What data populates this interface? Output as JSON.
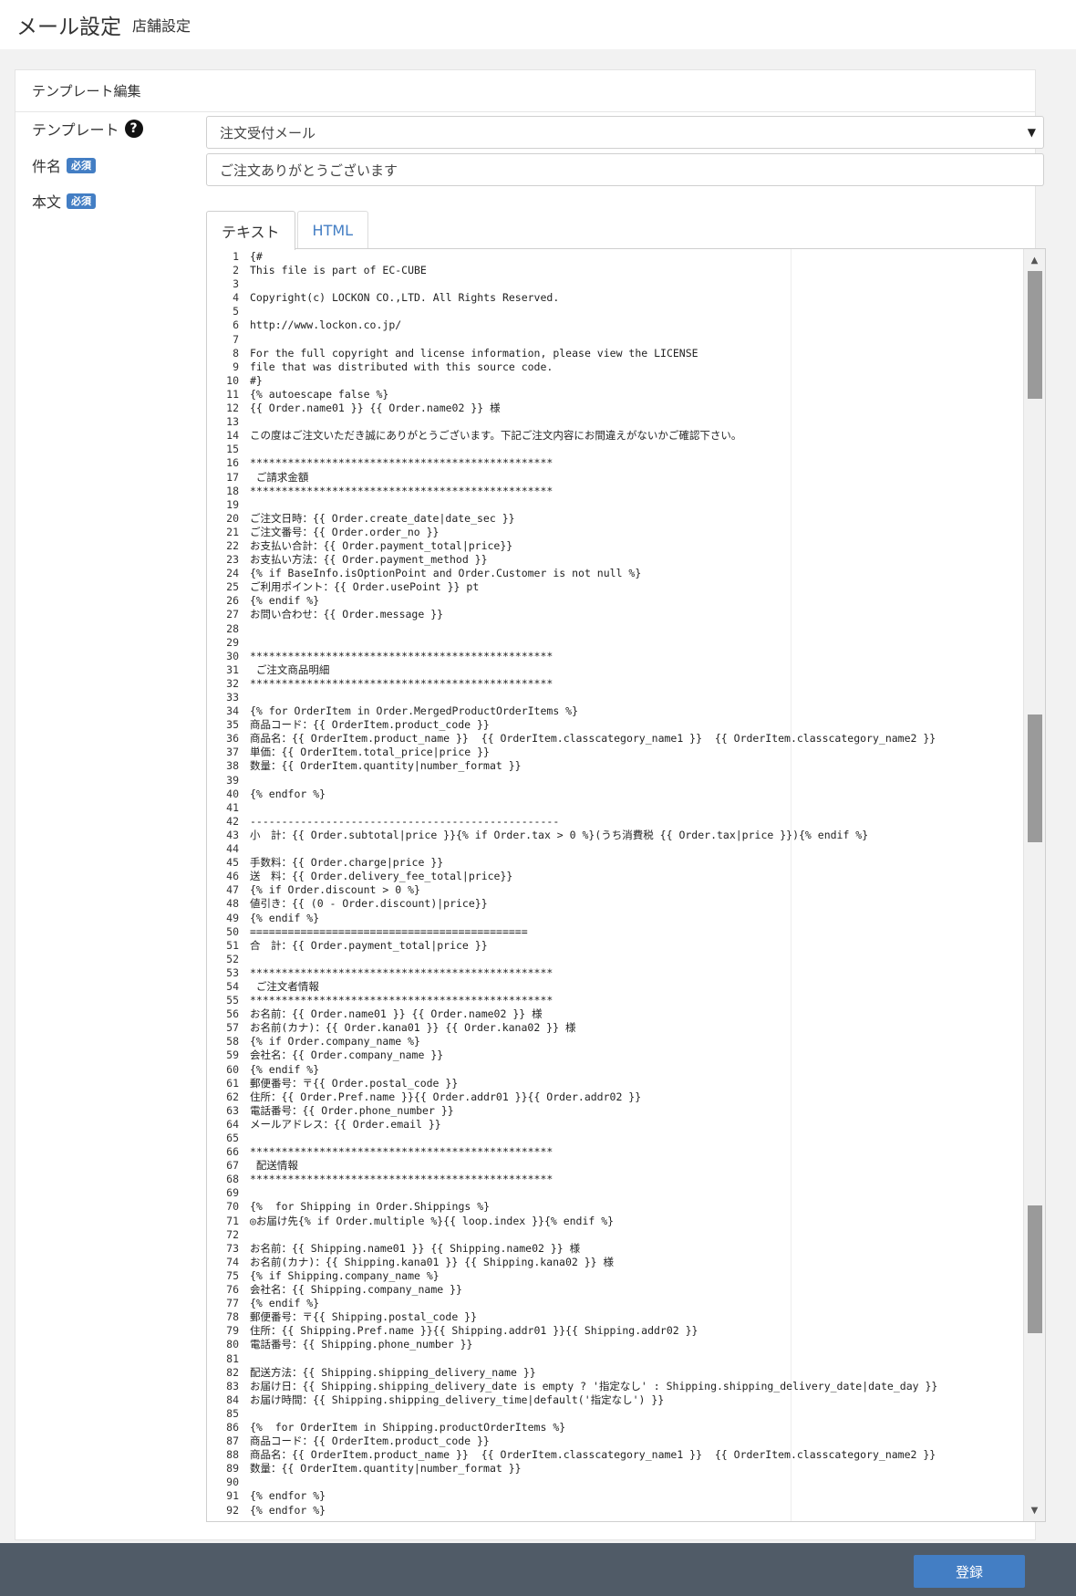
{
  "header": {
    "title": "メール設定",
    "subtitle": "店舗設定"
  },
  "card": {
    "title": "テンプレート編集"
  },
  "form": {
    "template_label": "テンプレート",
    "template_value": "注文受付メール",
    "subject_label": "件名",
    "required_badge": "必須",
    "subject_value": "ご注文ありがとうございます",
    "body_label": "本文"
  },
  "tabs": [
    {
      "label": "テキスト",
      "active": true
    },
    {
      "label": "HTML",
      "active": false
    }
  ],
  "editor": {
    "lines": [
      {
        "n": "1",
        "text": "{#"
      },
      {
        "n": "2",
        "text": "This file is part of EC-CUBE"
      },
      {
        "n": "3",
        "text": ""
      },
      {
        "n": "4",
        "text": "Copyright(c) LOCKON CO.,LTD. All Rights Reserved."
      },
      {
        "n": "5",
        "text": ""
      },
      {
        "n": "6",
        "text": "http://www.lockon.co.jp/"
      },
      {
        "n": "7",
        "text": ""
      },
      {
        "n": "8",
        "text": "For the full copyright and license information, please view the LICENSE"
      },
      {
        "n": "9",
        "text": "file that was distributed with this source code."
      },
      {
        "n": "10",
        "text": "#}"
      },
      {
        "n": "11",
        "text": "{% autoescape false %}"
      },
      {
        "n": "12",
        "text": "{{ Order.name01 }} {{ Order.name02 }} 様"
      },
      {
        "n": "13",
        "text": ""
      },
      {
        "n": "14",
        "text": "この度はご注文いただき誠にありがとうございます。下記ご注文内容にお間違えがないかご確認下さい。"
      },
      {
        "n": "15",
        "text": ""
      },
      {
        "n": "16",
        "text": "************************************************"
      },
      {
        "n": "17",
        "text": " ご請求金額"
      },
      {
        "n": "18",
        "text": "************************************************"
      },
      {
        "n": "19",
        "text": ""
      },
      {
        "n": "20",
        "text": "ご注文日時：{{ Order.create_date|date_sec }}"
      },
      {
        "n": "21",
        "text": "ご注文番号：{{ Order.order_no }}"
      },
      {
        "n": "22",
        "text": "お支払い合計：{{ Order.payment_total|price}}"
      },
      {
        "n": "23",
        "text": "お支払い方法：{{ Order.payment_method }}"
      },
      {
        "n": "24",
        "text": "{% if BaseInfo.isOptionPoint and Order.Customer is not null %}"
      },
      {
        "n": "25",
        "text": "ご利用ポイント：{{ Order.usePoint }} pt"
      },
      {
        "n": "26",
        "text": "{% endif %}"
      },
      {
        "n": "27",
        "text": "お問い合わせ：{{ Order.message }}"
      },
      {
        "n": "28",
        "text": ""
      },
      {
        "n": "29",
        "text": ""
      },
      {
        "n": "30",
        "text": "************************************************"
      },
      {
        "n": "31",
        "text": " ご注文商品明細"
      },
      {
        "n": "32",
        "text": "************************************************"
      },
      {
        "n": "33",
        "text": ""
      },
      {
        "n": "34",
        "text": "{% for OrderItem in Order.MergedProductOrderItems %}"
      },
      {
        "n": "35",
        "text": "商品コード：{{ OrderItem.product_code }}"
      },
      {
        "n": "36",
        "text": "商品名：{{ OrderItem.product_name }}  {{ OrderItem.classcategory_name1 }}  {{ OrderItem.classcategory_name2 }}"
      },
      {
        "n": "37",
        "text": "単価：{{ OrderItem.total_price|price }}"
      },
      {
        "n": "38",
        "text": "数量：{{ OrderItem.quantity|number_format }}"
      },
      {
        "n": "39",
        "text": ""
      },
      {
        "n": "40",
        "text": "{% endfor %}"
      },
      {
        "n": "41",
        "text": ""
      },
      {
        "n": "42",
        "text": "-------------------------------------------------"
      },
      {
        "n": "43",
        "text": "小　計：{{ Order.subtotal|price }}{% if Order.tax > 0 %}(うち消費税 {{ Order.tax|price }}){% endif %}"
      },
      {
        "n": "44",
        "text": ""
      },
      {
        "n": "45",
        "text": "手数料：{{ Order.charge|price }}"
      },
      {
        "n": "46",
        "text": "送　料：{{ Order.delivery_fee_total|price}}"
      },
      {
        "n": "47",
        "text": "{% if Order.discount > 0 %}"
      },
      {
        "n": "48",
        "text": "値引き：{{ (0 - Order.discount)|price}}"
      },
      {
        "n": "49",
        "text": "{% endif %}"
      },
      {
        "n": "50",
        "text": "============================================"
      },
      {
        "n": "51",
        "text": "合　計：{{ Order.payment_total|price }}"
      },
      {
        "n": "52",
        "text": ""
      },
      {
        "n": "53",
        "text": "************************************************"
      },
      {
        "n": "54",
        "text": " ご注文者情報"
      },
      {
        "n": "55",
        "text": "************************************************"
      },
      {
        "n": "56",
        "text": "お名前：{{ Order.name01 }} {{ Order.name02 }} 様"
      },
      {
        "n": "57",
        "text": "お名前(カナ)：{{ Order.kana01 }} {{ Order.kana02 }} 様"
      },
      {
        "n": "58",
        "text": "{% if Order.company_name %}"
      },
      {
        "n": "59",
        "text": "会社名：{{ Order.company_name }}"
      },
      {
        "n": "60",
        "text": "{% endif %}"
      },
      {
        "n": "61",
        "text": "郵便番号：〒{{ Order.postal_code }}"
      },
      {
        "n": "62",
        "text": "住所：{{ Order.Pref.name }}{{ Order.addr01 }}{{ Order.addr02 }}"
      },
      {
        "n": "63",
        "text": "電話番号：{{ Order.phone_number }}"
      },
      {
        "n": "64",
        "text": "メールアドレス：{{ Order.email }}"
      },
      {
        "n": "65",
        "text": ""
      },
      {
        "n": "66",
        "text": "************************************************"
      },
      {
        "n": "67",
        "text": " 配送情報"
      },
      {
        "n": "68",
        "text": "************************************************"
      },
      {
        "n": "69",
        "text": ""
      },
      {
        "n": "70",
        "text": "{%  for Shipping in Order.Shippings %}"
      },
      {
        "n": "71",
        "text": "◎お届け先{% if Order.multiple %}{{ loop.index }}{% endif %}"
      },
      {
        "n": "72",
        "text": ""
      },
      {
        "n": "73",
        "text": "お名前：{{ Shipping.name01 }} {{ Shipping.name02 }} 様"
      },
      {
        "n": "74",
        "text": "お名前(カナ)：{{ Shipping.kana01 }} {{ Shipping.kana02 }} 様"
      },
      {
        "n": "75",
        "text": "{% if Shipping.company_name %}"
      },
      {
        "n": "76",
        "text": "会社名：{{ Shipping.company_name }}"
      },
      {
        "n": "77",
        "text": "{% endif %}"
      },
      {
        "n": "78",
        "text": "郵便番号：〒{{ Shipping.postal_code }}"
      },
      {
        "n": "79",
        "text": "住所：{{ Shipping.Pref.name }}{{ Shipping.addr01 }}{{ Shipping.addr02 }}"
      },
      {
        "n": "80",
        "text": "電話番号：{{ Shipping.phone_number }}"
      },
      {
        "n": "81",
        "text": ""
      },
      {
        "n": "82",
        "text": "配送方法：{{ Shipping.shipping_delivery_name }}"
      },
      {
        "n": "83",
        "text": "お届け日：{{ Shipping.shipping_delivery_date is empty ? '指定なし' : Shipping.shipping_delivery_date|date_day }}"
      },
      {
        "n": "84",
        "text": "お届け時間：{{ Shipping.shipping_delivery_time|default('指定なし') }}"
      },
      {
        "n": "85",
        "text": ""
      },
      {
        "n": "86",
        "text": "{%  for OrderItem in Shipping.productOrderItems %}"
      },
      {
        "n": "87",
        "text": "商品コード：{{ OrderItem.product_code }}"
      },
      {
        "n": "88",
        "text": "商品名：{{ OrderItem.product_name }}  {{ OrderItem.classcategory_name1 }}  {{ OrderItem.classcategory_name2 }}"
      },
      {
        "n": "89",
        "text": "数量：{{ OrderItem.quantity|number_format }}"
      },
      {
        "n": "90",
        "text": ""
      },
      {
        "n": "91",
        "text": "{% endfor %}"
      },
      {
        "n": "92",
        "text": "{% endfor %}"
      }
    ]
  },
  "footer": {
    "submit_label": "登録"
  },
  "colors": {
    "accent": "#437ec4",
    "footer": "#505b67",
    "scroll_thumb": "#9a9a9a"
  }
}
